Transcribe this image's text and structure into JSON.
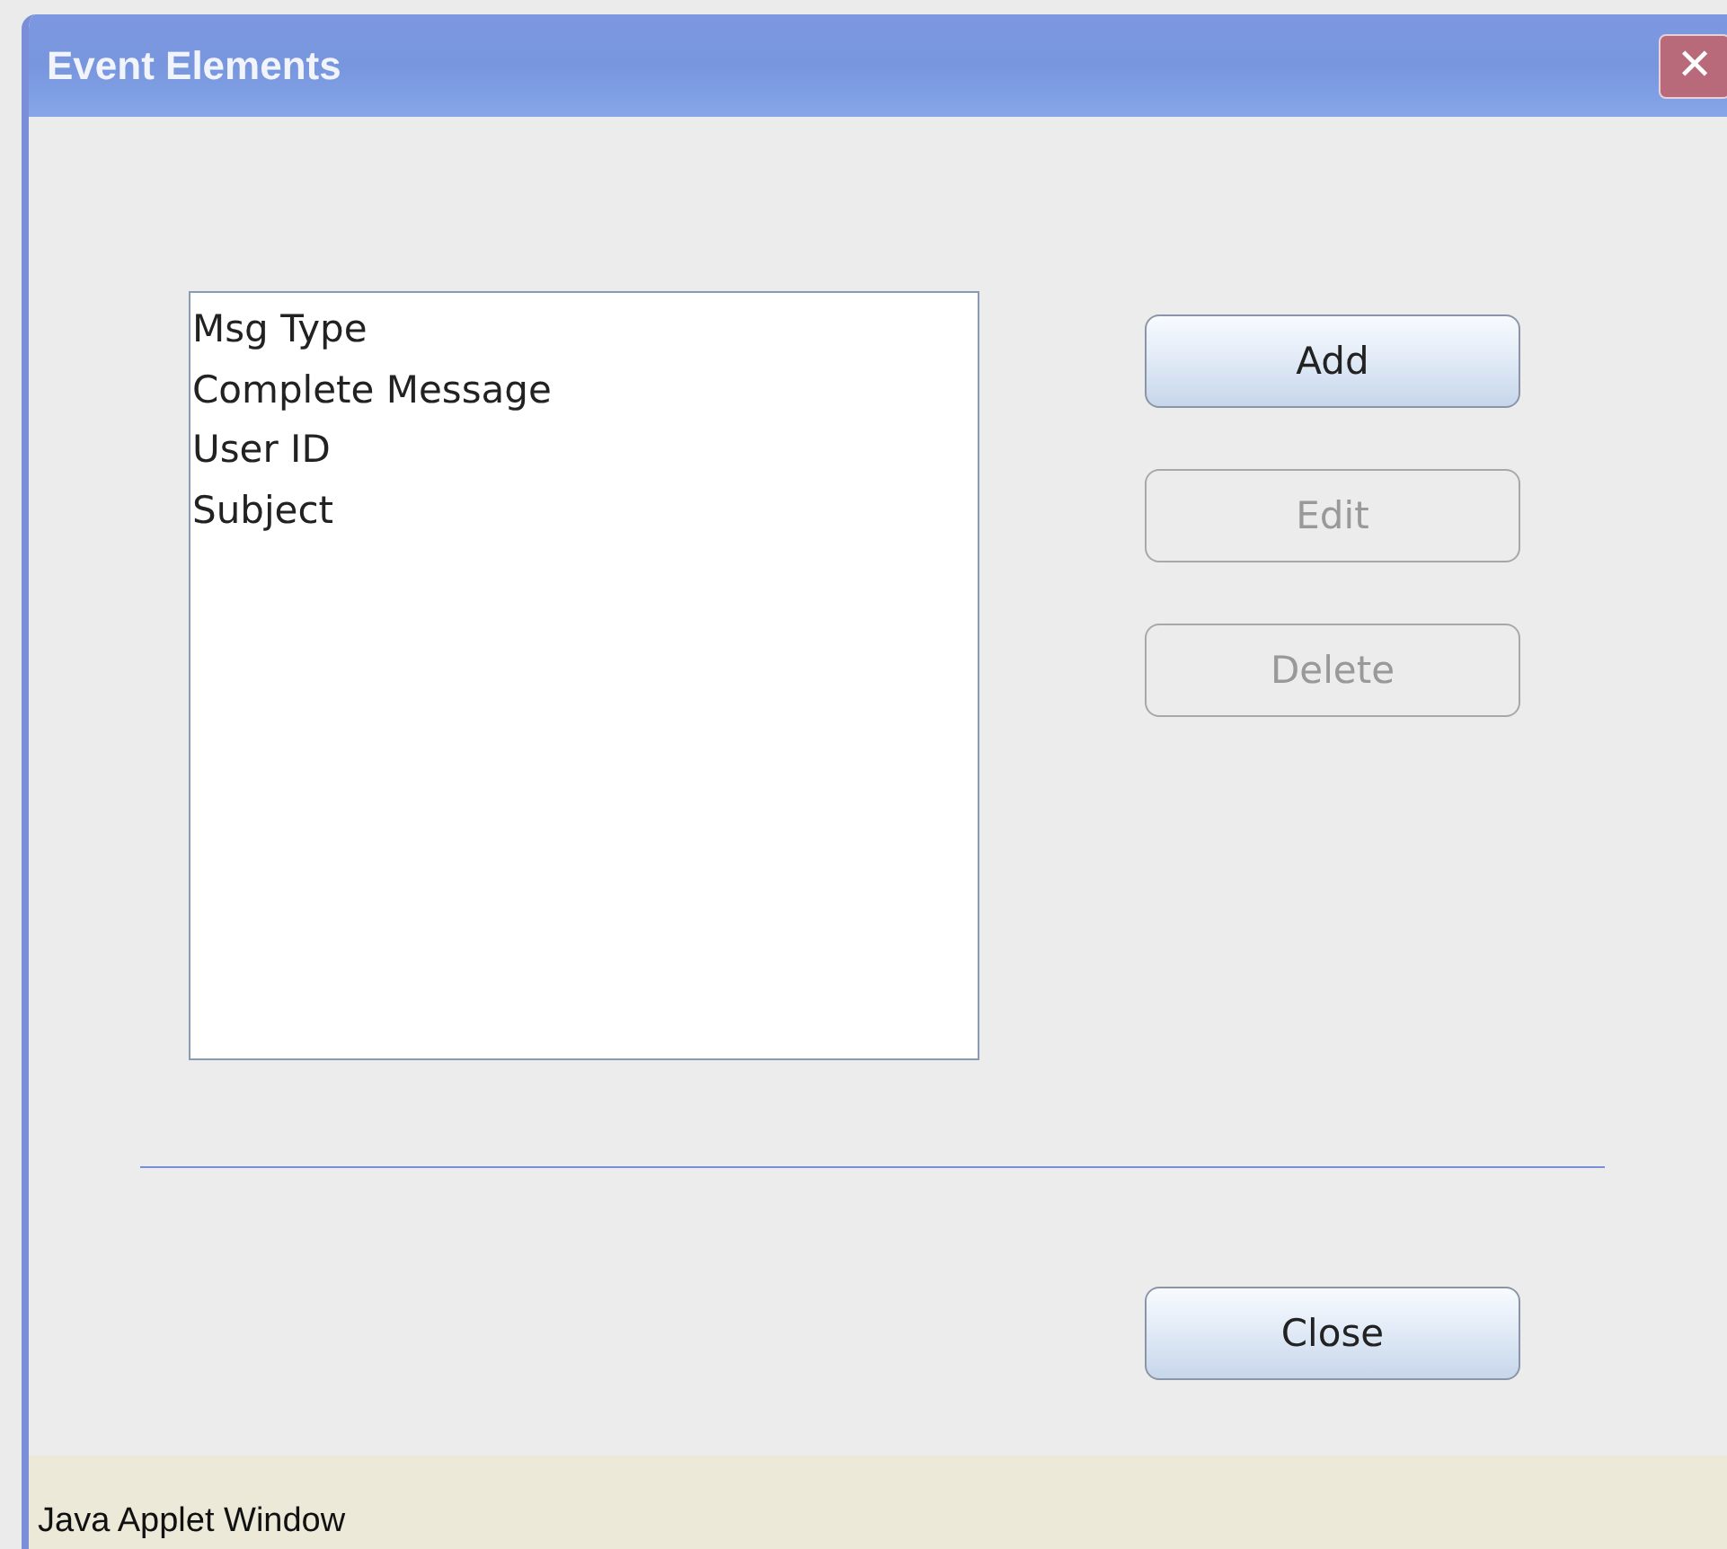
{
  "window": {
    "title": "Event Elements",
    "close_symbol": "✕"
  },
  "list": {
    "items": [
      "Msg Type",
      "Complete Message",
      "User ID",
      "Subject"
    ]
  },
  "buttons": [
    {
      "label": "Add",
      "disabled": false
    },
    {
      "label": "Edit",
      "disabled": true
    },
    {
      "label": "Delete",
      "disabled": true
    }
  ],
  "close_button": {
    "label": "Close"
  },
  "status_bar": "Java Applet Window"
}
